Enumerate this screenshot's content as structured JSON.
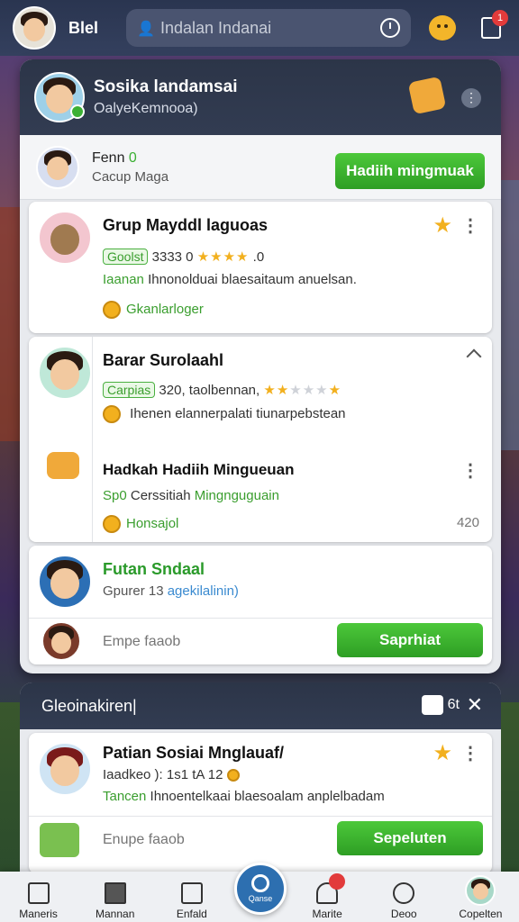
{
  "topbar": {
    "brand": "Blel",
    "search_placeholder": "Indalan Indanai",
    "notif_count": "1"
  },
  "profile": {
    "name": "Sosika landamsai",
    "subtitle": "OalyeKemnooa)"
  },
  "feed_row": {
    "title": "Fenn",
    "title_suffix": "0",
    "subtitle": "Cacup Maga",
    "button": "Hadiih mingmuak"
  },
  "card1": {
    "title": "Grup  Mayddl laguoas",
    "pill": "Goolst",
    "meta": "3333 0",
    "meta_end": ".0",
    "desc_lead": "Iaanan",
    "desc": "Ihnonolduai blaesaitaum anuelsan.",
    "footer": "Gkanlarloger"
  },
  "card2": {
    "title": "Barar Surolaahl",
    "pill": "Carpias",
    "meta": "320, taolbennan,",
    "desc": "Ihenen elannerpalati tiunarpebstean",
    "sub_title": "Hadkah Hadiih Mingueuan",
    "sub_meta_lead": "Sp0",
    "sub_meta": "Cerssitiah",
    "sub_meta_green": "Mingnguguain",
    "sub_footer": "Honsajol",
    "sub_footer_end": "420"
  },
  "card3": {
    "title": "Futan Sndaal",
    "sub": "Gpurer 13",
    "sub_link": "agekilalinin)",
    "input_placeholder": "Empe faaob",
    "button": "Saprhiat"
  },
  "panel2": {
    "title": "Gleoinakiren|",
    "count": "6t",
    "card_title": "Patian Sosiai Mnglauaf/",
    "card_meta": "Iaadkeo ): 1s1 tA 12",
    "card_desc_lead": "Tancen",
    "card_desc": "Ihnoentelkaai blaesoalam anplelbadam",
    "input_placeholder": "Enupe faaob",
    "button": "Sepeluten"
  },
  "bottom_nav": {
    "items": [
      "Maneris",
      "Mannan",
      "Enfald",
      "Marite",
      "Deoo",
      "Copelten"
    ],
    "center": "Qanse"
  },
  "colors": {
    "accent_green": "#3bb034",
    "header_dark": "#2c3548",
    "star": "#f2b01e",
    "nav_center": "#2d6fb0"
  }
}
